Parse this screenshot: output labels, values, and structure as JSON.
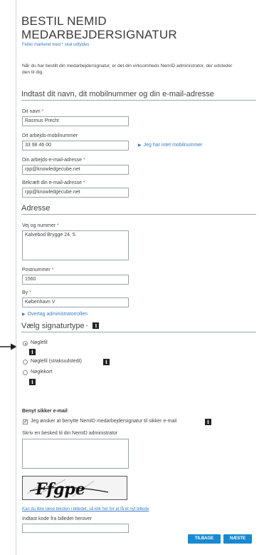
{
  "header": {
    "title_line1": "BESTIL NEMID",
    "title_line2": "MEDARBEJDERSIGNATUR",
    "required_note": "Felter markeret med * skal udfyldes"
  },
  "intro": "Når du har bestilt din medarbejdersignatur, er det din virksomheds NemID administrator, der udsteder den til dig.",
  "contact_section": {
    "title": "Indtast dit navn, dit mobilnummer og din e-mail-adresse",
    "name_label": "Dit navn",
    "name_value": "Rasmus Precht",
    "mobile_label": "Dit arbejds-mobilnummer",
    "mobile_value": "33 98 46 00",
    "no_mobile_link": "Jeg har intet mobilnummer",
    "email_label": "Din arbejds-e-mail-adresse",
    "email_value": "rpp@knowledgecube.net",
    "confirm_label": "Bekræft din e-mail-adresse",
    "confirm_value": "rpp@knowledgecube.net"
  },
  "address_section": {
    "title": "Adresse",
    "road_label": "Vej og nummer",
    "road_value": "Kalvebod Brygge 24, 5.",
    "postal_label": "Postnummer",
    "postal_value": "1560",
    "city_label": "By",
    "city_value": "København V",
    "admin_link": "Overtag administratorrollen"
  },
  "signature_section": {
    "title": "Vælg signaturtype",
    "options": [
      "Nøglefil",
      "Nøglefil (straksudstedt)",
      "Nøglekort"
    ],
    "selected": "Nøglefil"
  },
  "email_section": {
    "title": "Benyt sikker e-mail",
    "checkbox_label": "Jeg ønsker at benytte NemID medarbejdersignatur til sikker e-mail",
    "message_label": "Skriv en besked til din NemID administrator"
  },
  "captcha": {
    "text": "Ffgpe",
    "refresh_link": "Kan du ikke læse teksten i billedet, så klik her for at få et nyt billede",
    "code_label": "Indtast kode fra billedet herover"
  },
  "buttons": {
    "back": "TILBAGE",
    "next": "NÆSTE"
  },
  "icons": {
    "pointer": "arrow-right-icon",
    "info": "info-icon"
  },
  "colors": {
    "accent": "#3a7dc4",
    "button": "#1a8ad0"
  }
}
